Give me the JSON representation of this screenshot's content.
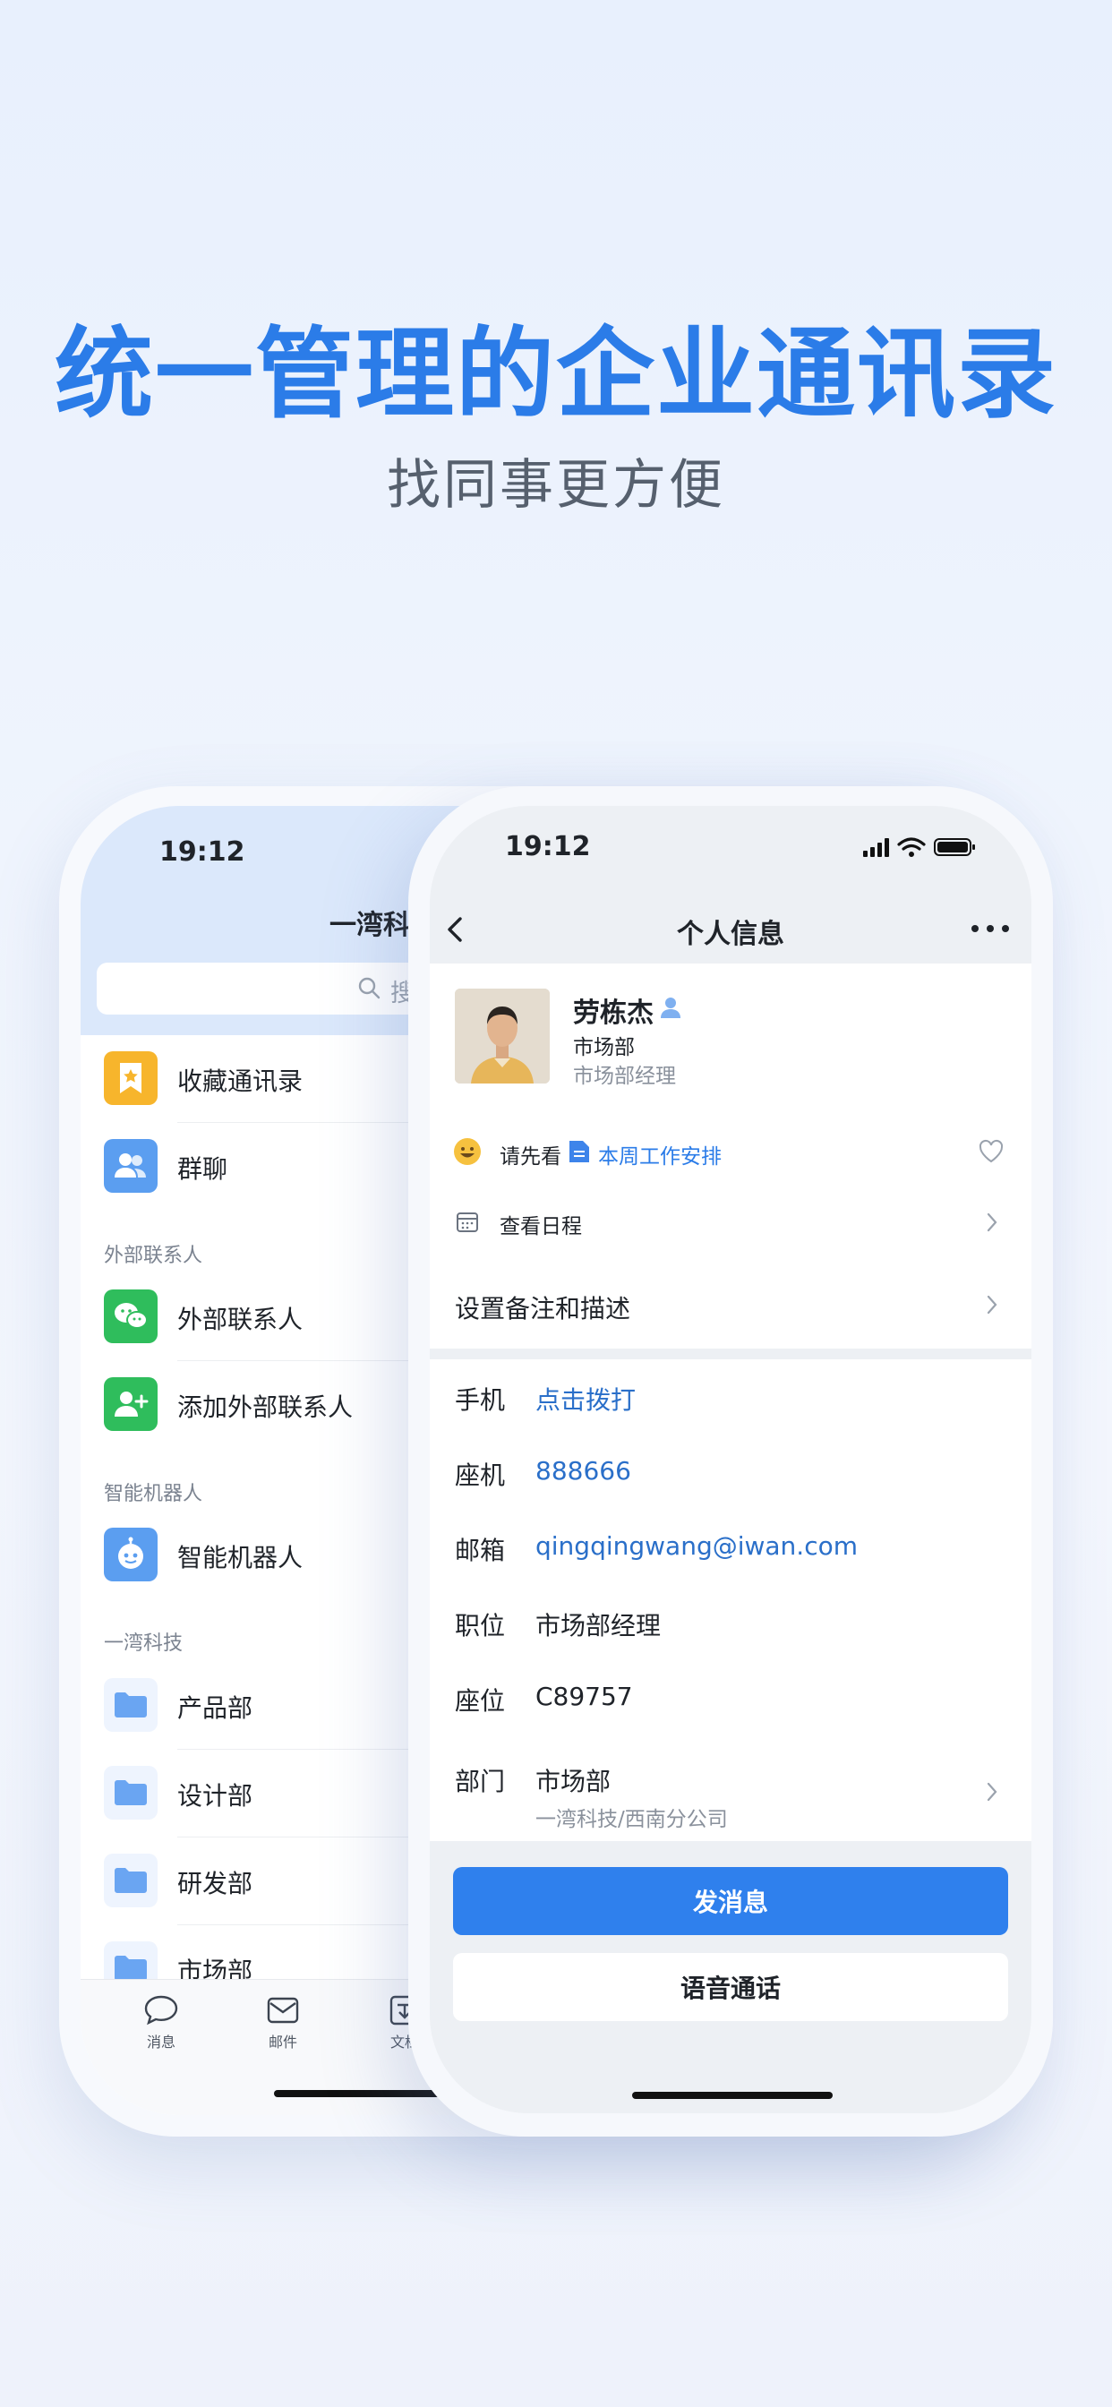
{
  "hero": {
    "title": "统一管理的企业通讯录",
    "subtitle": "找同事更方便"
  },
  "back_phone": {
    "time": "19:12",
    "title": "一湾科",
    "search_placeholder": "搜索",
    "items": [
      {
        "label": "收藏通讯录",
        "icon": "bookmark-star-icon",
        "color": "#f7b52c"
      },
      {
        "label": "群聊",
        "icon": "group-chat-icon",
        "color": "#5b9ef0"
      }
    ],
    "sections": [
      {
        "label": "外部联系人",
        "items": [
          {
            "label": "外部联系人",
            "icon": "wechat-icon",
            "color": "#2fbd5c"
          },
          {
            "label": "添加外部联系人",
            "icon": "add-contact-icon",
            "color": "#2fbd5c"
          }
        ]
      },
      {
        "label": "智能机器人",
        "items": [
          {
            "label": "智能机器人",
            "icon": "robot-icon",
            "color": "#5b9ef0"
          }
        ]
      },
      {
        "label": "一湾科技",
        "items": [
          {
            "label": "产品部",
            "icon": "folder-icon",
            "color": "#6aa5f2"
          },
          {
            "label": "设计部",
            "icon": "folder-icon",
            "color": "#6aa5f2"
          },
          {
            "label": "研发部",
            "icon": "folder-icon",
            "color": "#6aa5f2"
          },
          {
            "label": "市场部",
            "icon": "folder-icon",
            "color": "#6aa5f2"
          }
        ]
      }
    ],
    "tabs": [
      {
        "label": "消息",
        "icon": "message-icon"
      },
      {
        "label": "邮件",
        "icon": "mail-icon"
      },
      {
        "label": "文档",
        "icon": "document-icon"
      }
    ]
  },
  "front_phone": {
    "time": "19:12",
    "title": "个人信息",
    "profile": {
      "name": "劳栋杰",
      "department": "市场部",
      "position": "市场部经理"
    },
    "status": {
      "prefix": "请先看",
      "link": "本周工作安排"
    },
    "schedule_label": "查看日程",
    "remark_label": "设置备注和描述",
    "info": [
      {
        "key": "手机",
        "value": "点击拨打",
        "link": true
      },
      {
        "key": "座机",
        "value": "888666",
        "link": true
      },
      {
        "key": "邮箱",
        "value": "qingqingwang@iwan.com",
        "link": true
      },
      {
        "key": "职位",
        "value": "市场部经理",
        "link": false
      },
      {
        "key": "座位",
        "value": "C89757",
        "link": false
      }
    ],
    "department_row": {
      "key": "部门",
      "value": "市场部",
      "sub": "一湾科技/西南分公司"
    },
    "send_message_label": "发消息",
    "voice_call_label": "语音通话"
  }
}
